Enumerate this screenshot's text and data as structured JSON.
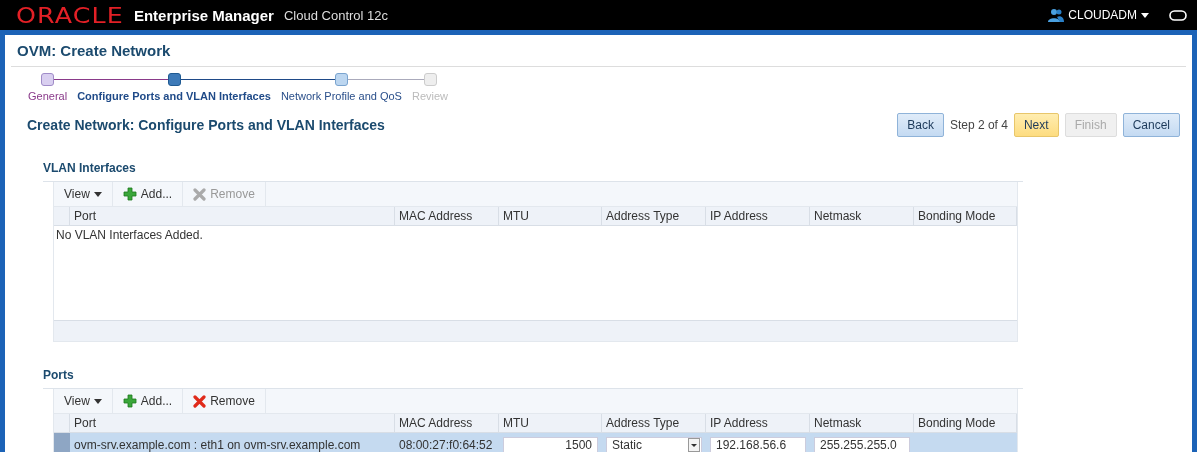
{
  "header": {
    "brand": "ORACLE",
    "product": "Enterprise Manager",
    "edition": "Cloud Control 12c",
    "user": "CLOUDADM"
  },
  "page_title": "OVM: Create Network",
  "train": [
    {
      "label": "General",
      "kind": "visited"
    },
    {
      "label": "Configure Ports and VLAN Interfaces",
      "kind": "current"
    },
    {
      "label": "Network Profile and QoS",
      "kind": "upcoming"
    },
    {
      "label": "Review",
      "kind": "disabled"
    }
  ],
  "step_title": "Create Network: Configure Ports and VLAN Interfaces",
  "buttons": [
    {
      "label": "Back",
      "disabled": false,
      "hovered": false
    },
    {
      "label": "Next",
      "disabled": false,
      "hovered": true
    },
    {
      "label": "Finish",
      "disabled": true,
      "hovered": false
    },
    {
      "label": "Cancel",
      "disabled": false,
      "hovered": false
    }
  ],
  "step_indicator": "Step 2 of 4",
  "vlan_interfaces": {
    "title": "VLAN Interfaces",
    "toolbar": {
      "view": "View",
      "add": "Add...",
      "remove": "Remove",
      "remove_disabled": true
    },
    "columns": [
      "Port",
      "MAC Address",
      "MTU",
      "Address Type",
      "IP Address",
      "Netmask",
      "Bonding Mode"
    ],
    "empty_message": "No VLAN Interfaces Added."
  },
  "ports": {
    "title": "Ports",
    "toolbar": {
      "view": "View",
      "add": "Add...",
      "remove": "Remove",
      "remove_disabled": false
    },
    "columns": [
      "Port",
      "MAC Address",
      "MTU",
      "Address Type",
      "IP Address",
      "Netmask",
      "Bonding Mode"
    ],
    "rows": [
      {
        "port": "ovm-srv.example.com : eth1 on ovm-srv.example.com",
        "mac_address": "08:00:27:f0:64:52",
        "mtu": "1500",
        "address_type": "Static",
        "ip_address": "192.168.56.6",
        "netmask": "255.255.255.0",
        "selected": true
      }
    ]
  }
}
